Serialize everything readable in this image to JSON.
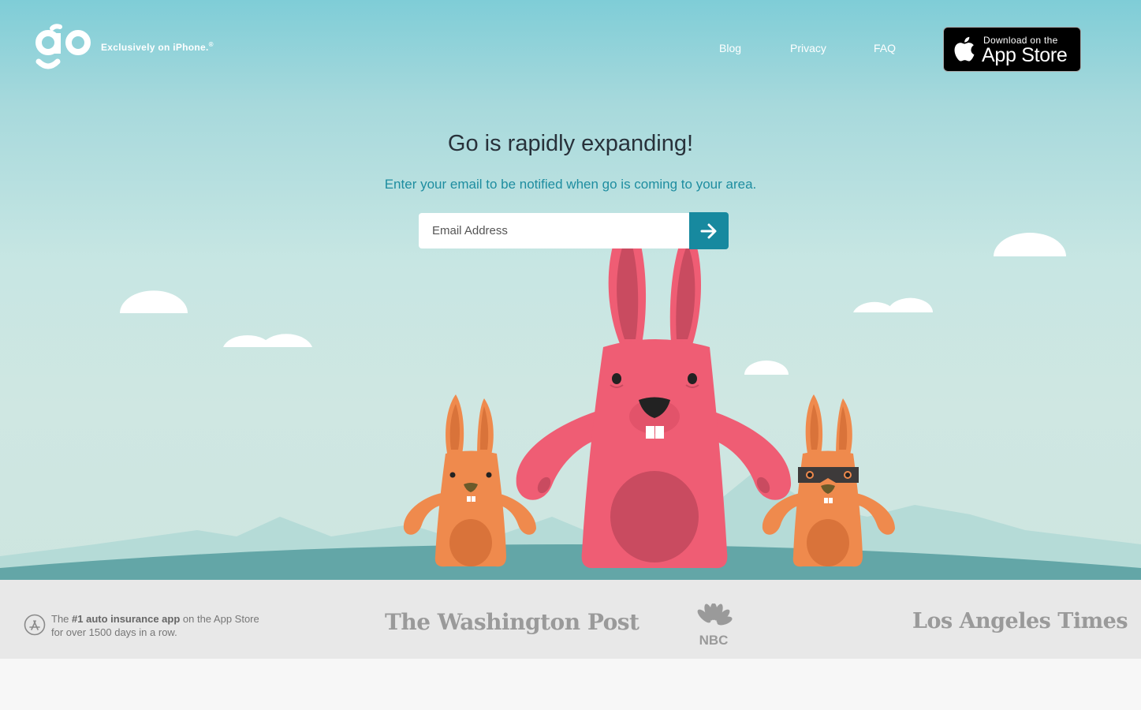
{
  "header": {
    "tagline": "Exclusively on iPhone.",
    "tagline_mark": "®",
    "nav": [
      {
        "label": "Blog"
      },
      {
        "label": "Privacy"
      },
      {
        "label": "FAQ"
      }
    ],
    "appstore": {
      "small": "Download on the",
      "big": "App Store"
    }
  },
  "hero": {
    "headline": "Go is rapidly expanding!",
    "subtitle": "Enter your email to be notified when go is coming to your area.",
    "email_placeholder": "Email Address"
  },
  "press": {
    "award_prefix": "The ",
    "award_bold": "#1 auto insurance app",
    "award_suffix": " on the App Store",
    "award_line2": "for over 1500 days in a row.",
    "logos": [
      "The Washington Post",
      "NBC",
      "Los Angeles Times"
    ]
  },
  "colors": {
    "accent": "#17899f",
    "pink_bunny": "#ef5d74",
    "orange_bunny": "#ef8a4d",
    "ground": "#5fa5a6"
  },
  "icons": [
    "go-logo",
    "apple-icon",
    "arrow-right-icon",
    "app-store-badge-icon",
    "nbc-peacock-icon"
  ]
}
